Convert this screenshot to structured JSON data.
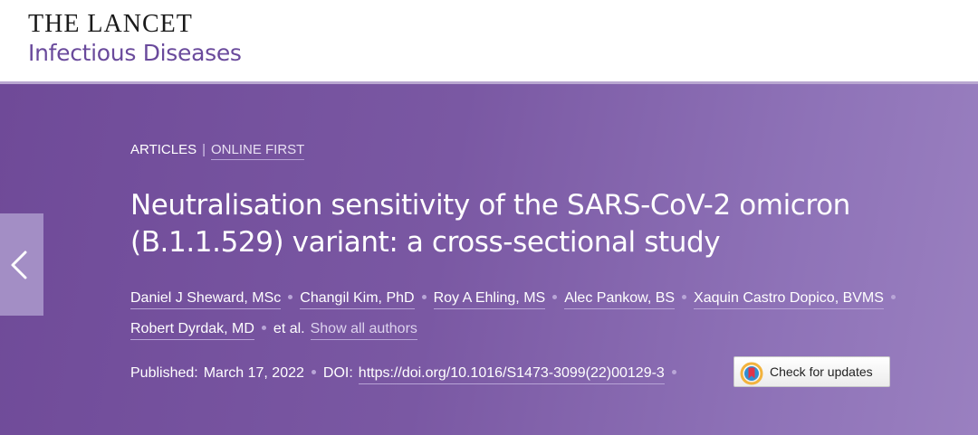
{
  "journal": {
    "name_top": "THE LANCET",
    "name_bottom": "Infectious Diseases"
  },
  "article": {
    "category": "ARTICLES",
    "status": "ONLINE FIRST",
    "title": "Neutralisation sensitivity of the SARS-CoV-2 omicron (B.1.1.529) variant: a cross-sectional study",
    "authors": [
      "Daniel J Sheward, MSc",
      "Changil Kim, PhD",
      "Roy A Ehling, MS",
      "Alec Pankow, BS",
      "Xaquin Castro Dopico, BVMS",
      "Robert Dyrdak, MD"
    ],
    "et_al": "et al.",
    "show_all_label": "Show all authors",
    "published_label": "Published:",
    "published_date": "March 17, 2022",
    "doi_label": "DOI:",
    "doi_url": "https://doi.org/10.1016/S1473-3099(22)00129-3",
    "check_updates_label": "Check for updates"
  },
  "colors": {
    "brand_purple": "#6a4a9c",
    "hero_start": "#6f4a98",
    "hero_end": "#9a80c0"
  },
  "icons": {
    "prev": "chevron-left-icon",
    "check_updates": "crossmark-icon"
  }
}
